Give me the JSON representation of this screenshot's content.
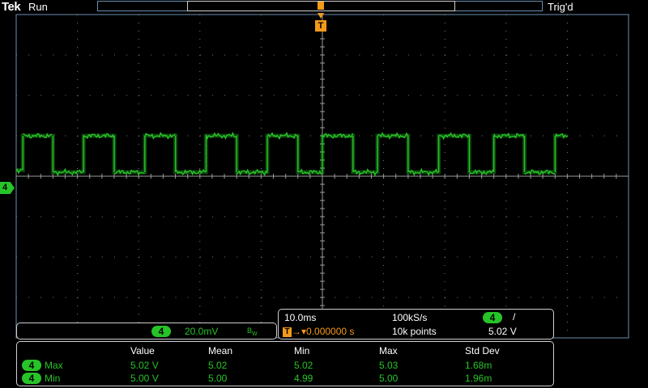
{
  "header": {
    "logo": "Tek",
    "run_state": "Run",
    "trigger_status": "Trig'd"
  },
  "trigger_marker": "T",
  "channel_marker": "4",
  "channel_readout": {
    "badge": "4",
    "scale": "20.0mV",
    "bandwidth_icon": "bandwidth-limit-icon"
  },
  "timebase": {
    "time_per_div": "10.0ms",
    "sample_rate": "100kS/s",
    "badge": "4",
    "slope": "/",
    "trigger_label": "T",
    "position": "0.000000 s",
    "record_length": "10k points",
    "trigger_level": "5.02 V"
  },
  "measurements": {
    "headers": [
      "Value",
      "Mean",
      "Min",
      "Max",
      "Std Dev"
    ],
    "rows": [
      {
        "badge": "4",
        "label": "Max",
        "cells": [
          "5.02 V",
          "5.02",
          "5.02",
          "5.03",
          "1.68m"
        ]
      },
      {
        "badge": "4",
        "label": "Min",
        "cells": [
          "5.00 V",
          "5.00",
          "4.99",
          "5.00",
          "1.96m"
        ]
      }
    ]
  },
  "colors": {
    "channel4": "#27c427",
    "trigger": "#f39a1b",
    "graticule": "#6a8fb0",
    "background": "#000000"
  },
  "chart_data": {
    "type": "line",
    "series": [
      {
        "name": "4",
        "description_free": true,
        "x": [
          -50,
          -48.9,
          -48.9,
          -44,
          -44,
          -39,
          -39,
          -34,
          -34,
          -29,
          -29,
          -24,
          -24,
          -19,
          -19,
          -14,
          -14,
          -9,
          -9,
          -4,
          -4,
          0,
          0,
          5,
          5,
          9,
          9,
          14,
          14,
          19,
          19,
          24,
          24,
          28,
          28,
          33,
          33,
          38,
          38,
          40
        ],
        "y": [
          5.003,
          5.003,
          5.02,
          5.02,
          5.002,
          5.002,
          5.02,
          5.02,
          5.002,
          5.002,
          5.02,
          5.02,
          5.002,
          5.002,
          5.02,
          5.02,
          5.002,
          5.002,
          5.02,
          5.02,
          5.002,
          5.002,
          5.02,
          5.02,
          5.002,
          5.002,
          5.02,
          5.02,
          5.002,
          5.002,
          5.02,
          5.02,
          5.002,
          5.002,
          5.02,
          5.02,
          5.002,
          5.002,
          5.02,
          5.02
        ]
      }
    ],
    "xlim": [
      -50,
      50
    ],
    "ylim": [
      4.92,
      5.08
    ],
    "grid": true
  }
}
